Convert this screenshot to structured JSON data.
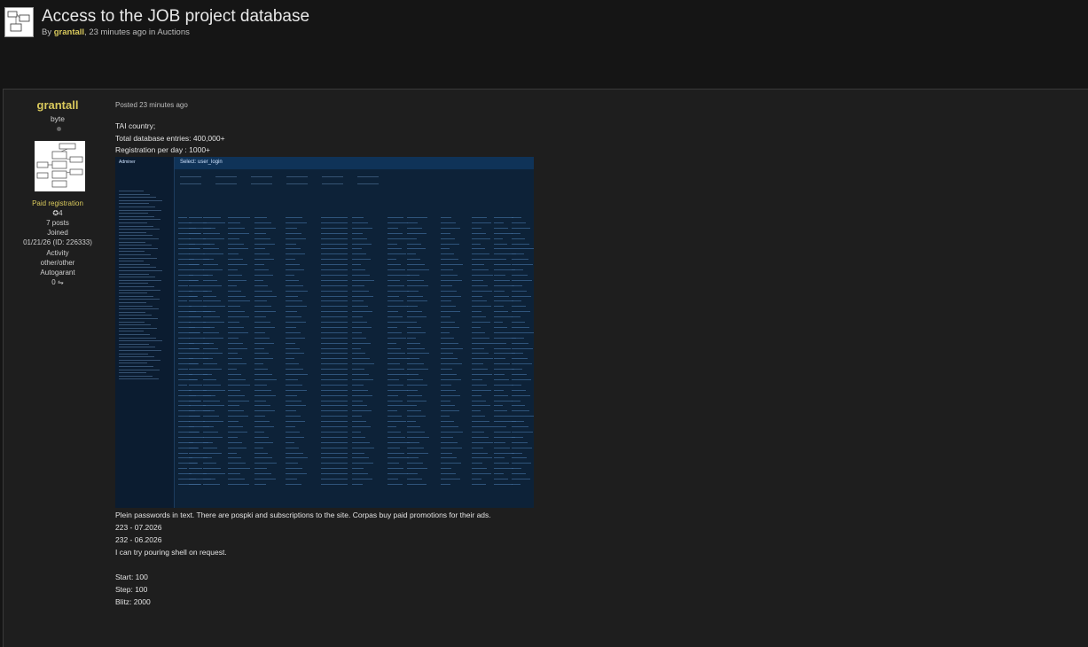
{
  "thread": {
    "title": "Access to the JOB project database",
    "meta_prefix": "By",
    "author": "grantall",
    "meta_suffix": ", 23 minutes ago in Auctions"
  },
  "user": {
    "name": "grantall",
    "rank": "byte",
    "group": "Paid registration",
    "reputation": "4",
    "posts": "7 posts",
    "joined_label": "Joined",
    "joined_value": "01/21/26 (ID: 226333)",
    "activity_label": "Activity",
    "activity_value": "other/other",
    "autogarant": "Autogarant",
    "autogarant_value": "0"
  },
  "post": {
    "posted": "Posted 23 minutes ago",
    "lines_top": [
      "TAI country;",
      "Total database entries: 400,000+",
      "Registration per day : 1000+"
    ],
    "lines_bottom": [
      "Plein passwords in text. There are pospki and subscriptions to the site. Corpas buy paid promotions for their ads.",
      "223 - 07.2026",
      "232 - 06.2026",
      "I can try pouring shell on request.",
      "",
      "Start: 100",
      "Step: 100",
      "Blitz: 2000"
    ]
  },
  "embedded_screenshot": {
    "logo": "Adminer",
    "title": "Select: user_login"
  },
  "colors": {
    "background": "#151515",
    "post_background": "#1e1e1e",
    "username": "#d9c95c",
    "screenshot_bg": "#0d2238"
  }
}
